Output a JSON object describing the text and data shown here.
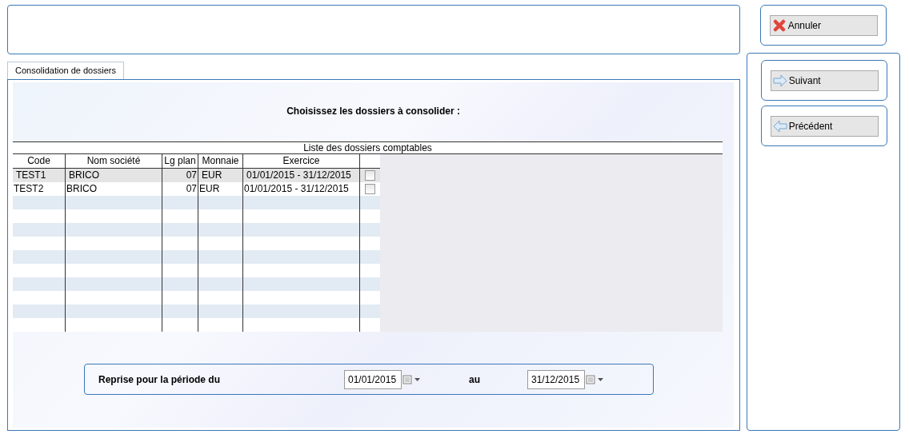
{
  "actions": {
    "cancel": "Annuler",
    "next": "Suivant",
    "previous": "Précédent"
  },
  "tabs": [
    {
      "label": "Consolidation de dossiers",
      "selected": true
    }
  ],
  "heading": "Choisissez les dossiers à consolider :",
  "table": {
    "title": "Liste des dossiers comptables",
    "columns": [
      "Code",
      "Nom société",
      "Lg plan",
      "Monnaie",
      "Exercice"
    ],
    "rows": [
      {
        "cells": [
          "TEST1",
          "BRICO",
          "07",
          "EUR",
          "01/01/2015 - 31/12/2015"
        ],
        "checked": false,
        "selected": true
      },
      {
        "cells": [
          "TEST2",
          "BRICO",
          "07",
          "EUR",
          "01/01/2015 - 31/12/2015"
        ],
        "checked": false,
        "selected": false
      }
    ]
  },
  "period": {
    "label": "Reprise pour la période du",
    "from": "01/01/2015",
    "to_label": "au",
    "to": "31/12/2015"
  }
}
